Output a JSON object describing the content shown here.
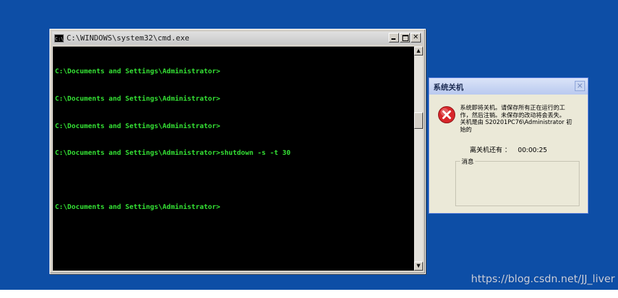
{
  "cmd": {
    "title": "C:\\WINDOWS\\system32\\cmd.exe",
    "icon_label": "C:\\",
    "lines": [
      "C:\\Documents and Settings\\Administrator>",
      "C:\\Documents and Settings\\Administrator>",
      "C:\\Documents and Settings\\Administrator>",
      "C:\\Documents and Settings\\Administrator>shutdown -s -t 30",
      "",
      "C:\\Documents and Settings\\Administrator>"
    ],
    "close_glyph": "✕",
    "scroll_up_glyph": "▲",
    "scroll_down_glyph": "▼"
  },
  "dialog": {
    "title": "系统关机",
    "close_glyph": "✕",
    "message_lines": [
      "系统即将关机。请保存所有正在运行的工",
      "作，然后注销。未保存的改动将会丢失。",
      "关机是由 S20201PC76\\Administrator 初",
      "始的"
    ],
    "countdown_label": "离关机还有 ：",
    "countdown_value": "00:00:25",
    "message_group_label": "消息"
  },
  "watermark": "https://blog.csdn.net/JJ_liver",
  "colors": {
    "desktop": "#0d4ea6",
    "console_text": "#34e134",
    "console_bg": "#000000",
    "error_red": "#d8262a"
  }
}
